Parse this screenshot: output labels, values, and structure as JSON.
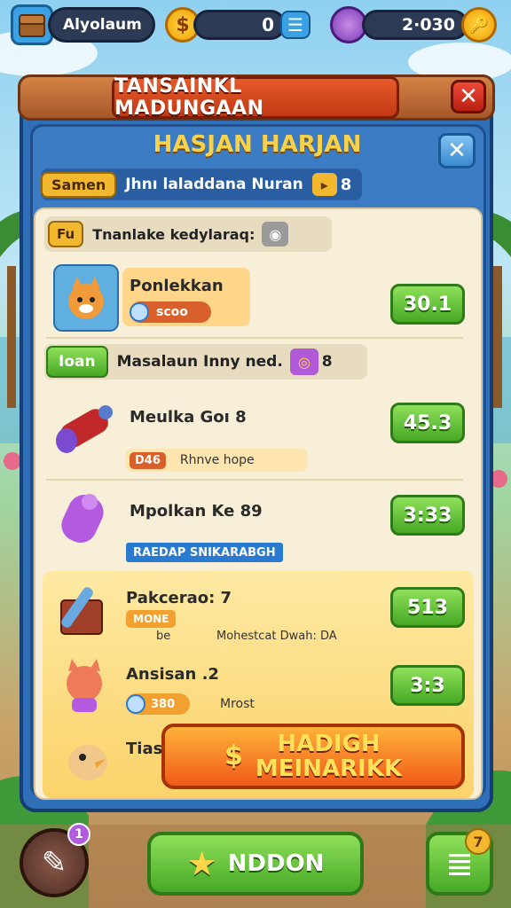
{
  "hud": {
    "player_name": "Alyolaum",
    "coins": "0",
    "coin_glyph": "$",
    "gems_value": "2·030",
    "menu_glyph": "☰",
    "key_glyph": "🔑"
  },
  "panel": {
    "title": "TANSAINKL MADUNGAAN",
    "subtitle": "HASJAN HARJAN",
    "close_glyph": "✕",
    "tag_label": "Samen",
    "tag_text": "Jhnı laladdana Nuran",
    "tag_count": "8",
    "tag_icon_glyph": "▸"
  },
  "section1": {
    "badge": "Fu",
    "label": "Tnanlake kedylaraq:",
    "icon_glyph": "◉"
  },
  "items": [
    {
      "name": "Ponlekkan",
      "sub": "scoo",
      "price": "30.1",
      "icon": "fox-icon"
    },
    {
      "name": "Meulka Goı 8",
      "sub_badge": "D46",
      "sub": "Rhnve hope",
      "price": "45.3",
      "icon": "cannon-icon"
    },
    {
      "name": "Mpolkan Ke 89",
      "sub": "RAEDAP SNIKARABGH",
      "price": "3:33",
      "icon": "potion-icon"
    },
    {
      "name": "Pakcerao: 7",
      "sub_badge": "MONE",
      "sub": "Mohestcat Dwah: DA",
      "sub_prefix": "be",
      "price": "513",
      "icon": "chest-icon"
    },
    {
      "name": "Ansisan .2",
      "sub": "Mrost",
      "sub_badge": "380",
      "price": "3:3",
      "icon": "cat-icon"
    },
    {
      "name": "Tias",
      "icon": "bird-icon"
    }
  ],
  "section2": {
    "badge": "Ioan",
    "label": "Masalaun Inny ned.",
    "count": "8",
    "icon_glyph": "◎"
  },
  "big_button": {
    "glyph": "$",
    "line1": "HADIGH",
    "line2": "MEINARIKK"
  },
  "bottom": {
    "main_label": "NDDON",
    "star_glyph": "★",
    "left_badge": "1",
    "right_badge": "7",
    "left_glyph": "✎",
    "right_glyph": "≣"
  }
}
